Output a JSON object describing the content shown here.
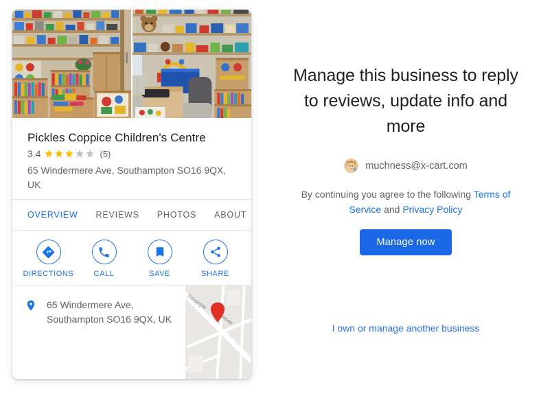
{
  "business_card": {
    "photos": [
      {
        "name": "interior-photo-bookshelves-toys",
        "alt": "Children's centre room with bookshelves and toys"
      },
      {
        "name": "interior-photo-desk-blue-box",
        "alt": "Room with desk, chair, blue storage box and shelving"
      }
    ],
    "name": "Pickles Coppice Children's Centre",
    "rating": {
      "value": "3.4",
      "stars_filled": 3,
      "stars_total": 5,
      "count": "(5)",
      "star_color": "#fbbc04",
      "star_empty_color": "#bdc1c6"
    },
    "address": "65 Windermere Ave, Southampton SO16 9QX, UK",
    "tabs": [
      {
        "label": "OVERVIEW",
        "active": true
      },
      {
        "label": "REVIEWS",
        "active": false
      },
      {
        "label": "PHOTOS",
        "active": false
      },
      {
        "label": "ABOUT",
        "active": false
      }
    ],
    "actions": [
      {
        "label": "DIRECTIONS",
        "icon": "directions-icon"
      },
      {
        "label": "CALL",
        "icon": "phone-icon"
      },
      {
        "label": "SAVE",
        "icon": "bookmark-icon"
      },
      {
        "label": "SHARE",
        "icon": "share-icon"
      }
    ],
    "address_block": {
      "icon": "map-pin-icon",
      "text": "65 Windermere Ave, Southampton SO16 9QX, UK"
    },
    "map": {
      "street_label_1": "Уиндерм",
      "street_label_2": "авеню",
      "pin_color": "#e03127"
    },
    "accent_color": "#1a73e8"
  },
  "right_panel": {
    "headline": "Manage this business to reply to reviews, update info and more",
    "account": {
      "avatar": "user-avatar",
      "email": "muchness@x-cart.com"
    },
    "terms": {
      "prefix": "By continuing you agree to the following ",
      "terms_link": "Terms of Service",
      "conjunction": " and ",
      "privacy_link": "Privacy Policy"
    },
    "primary_button": {
      "label": "Manage now",
      "color": "#1a68e5"
    },
    "secondary_link": "I own or manage another business"
  }
}
